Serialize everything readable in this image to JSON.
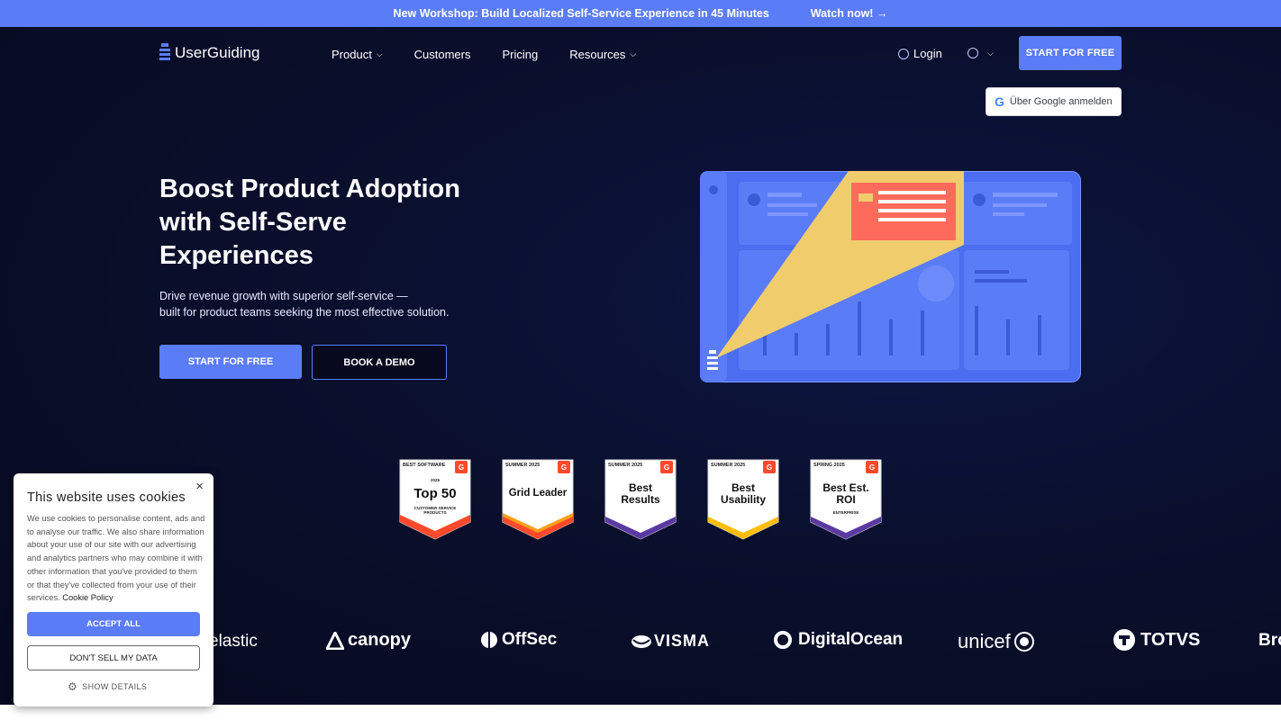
{
  "announcement": {
    "text": "New Workshop: Build Localized Self-Service Experience in 45 Minutes",
    "cta": "Watch now! →"
  },
  "nav": {
    "logo": "UserGuiding",
    "items": [
      {
        "label": "Product",
        "has_dropdown": true
      },
      {
        "label": "Customers",
        "has_dropdown": false
      },
      {
        "label": "Pricing",
        "has_dropdown": false
      },
      {
        "label": "Resources",
        "has_dropdown": true
      }
    ],
    "login": "Login",
    "start_button": "START FOR FREE",
    "google_signin": "Über Google anmelden"
  },
  "hero": {
    "title_line1": "Boost Product Adoption",
    "title_line2": "with Self-Serve",
    "title_line3": "Experiences",
    "subtitle_line1": "Drive revenue growth with superior self-service —",
    "subtitle_line2": "built for product teams seeking the most effective solution.",
    "primary_button": "START FOR FREE",
    "secondary_button": "BOOK A DEMO"
  },
  "badges": [
    {
      "header": "BEST SOFTWARE",
      "year": "2025",
      "main": "Top 50",
      "sub": "CUSTOMER SERVICE PRODUCTS",
      "accent": "#ff492c"
    },
    {
      "header": "SUMMER 2025",
      "year": "",
      "main": "Grid Leader",
      "sub": "",
      "accent": "#ff492c"
    },
    {
      "header": "SUMMER 2025",
      "year": "",
      "main": "Best Results",
      "sub": "",
      "accent": "#5a39a2"
    },
    {
      "header": "SUMMER 2025",
      "year": "",
      "main": "Best Usability",
      "sub": "",
      "accent": "#ffbe0b"
    },
    {
      "header": "SPRING 2025",
      "year": "",
      "main": "Best Est. ROI",
      "sub": "ENTERPRISE",
      "accent": "#5a39a2"
    }
  ],
  "customer_logos": [
    "elastic",
    "canopy",
    "OffSec",
    "VISMA",
    "DigitalOcean",
    "unicef",
    "TOTVS",
    "Bro"
  ],
  "cookie": {
    "title": "This website uses cookies",
    "body": "We use cookies to personalise content, ads and to analyse our traffic. We also share information about your use of our site with our advertising and analytics partners who may combine it with other information that you've provided to them or that they've collected from your use of their services.",
    "policy_link": "Cookie Policy",
    "accept": "ACCEPT ALL",
    "dont_sell": "DON'T SELL MY DATA",
    "details": "SHOW DETAILS",
    "close": "×"
  },
  "colors": {
    "brand": "#5b7cf7",
    "hero_bg": "#0a0f2d",
    "illustration_blue": "#5b7cf7",
    "illustration_yellow": "#f5d46a",
    "illustration_red": "#ff6b5b"
  }
}
